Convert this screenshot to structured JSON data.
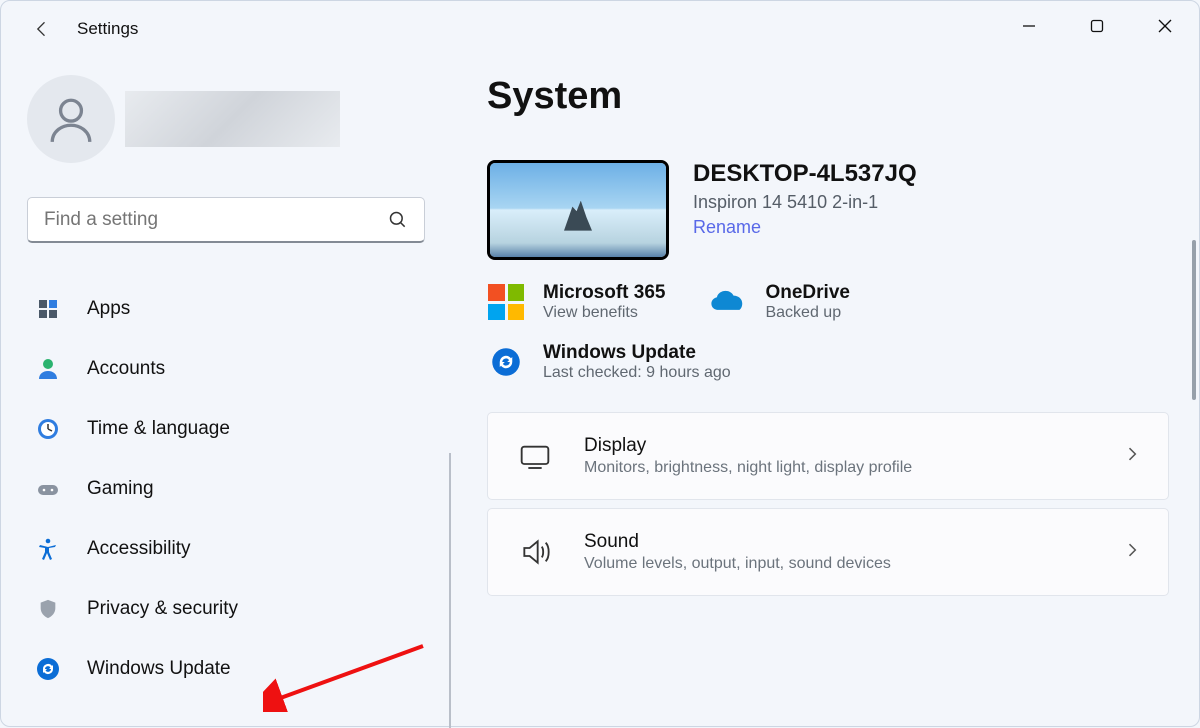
{
  "app_title": "Settings",
  "search": {
    "placeholder": "Find a setting"
  },
  "nav": [
    {
      "label": "Apps"
    },
    {
      "label": "Accounts"
    },
    {
      "label": "Time & language"
    },
    {
      "label": "Gaming"
    },
    {
      "label": "Accessibility"
    },
    {
      "label": "Privacy & security"
    },
    {
      "label": "Windows Update"
    }
  ],
  "page": {
    "title": "System"
  },
  "device": {
    "name": "DESKTOP-4L537JQ",
    "model": "Inspiron 14 5410 2-in-1",
    "rename": "Rename"
  },
  "cards": {
    "m365": {
      "title": "Microsoft 365",
      "sub": "View benefits"
    },
    "onedrive": {
      "title": "OneDrive",
      "sub": "Backed up"
    },
    "wu": {
      "title": "Windows Update",
      "sub": "Last checked: 9 hours ago"
    }
  },
  "settings": [
    {
      "title": "Display",
      "sub": "Monitors, brightness, night light, display profile"
    },
    {
      "title": "Sound",
      "sub": "Volume levels, output, input, sound devices"
    }
  ]
}
